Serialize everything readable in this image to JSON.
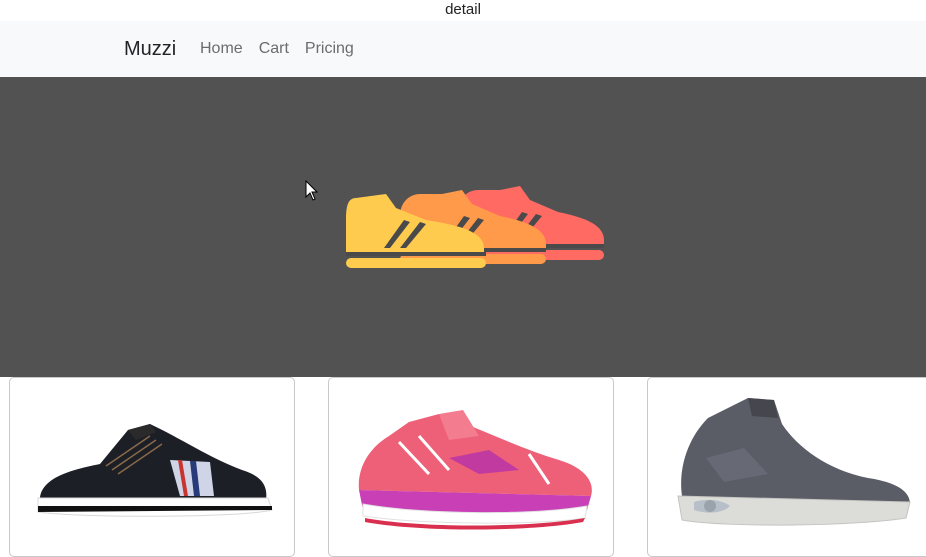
{
  "window": {
    "title": "detail"
  },
  "navbar": {
    "brand": "Muzzi",
    "links": [
      {
        "label": "Home"
      },
      {
        "label": "Cart"
      },
      {
        "label": "Pricing"
      }
    ]
  },
  "hero": {
    "logo_icon": "shoe-stack-icon",
    "colors": {
      "yellow": "#ffcb4f",
      "orange": "#ff9a4a",
      "red": "#ff6a63",
      "background": "#525252"
    }
  },
  "products": [
    {
      "image_icon": "black-sneaker-image"
    },
    {
      "image_icon": "pink-running-shoe-image"
    },
    {
      "image_icon": "grey-high-top-sneaker-image"
    }
  ]
}
